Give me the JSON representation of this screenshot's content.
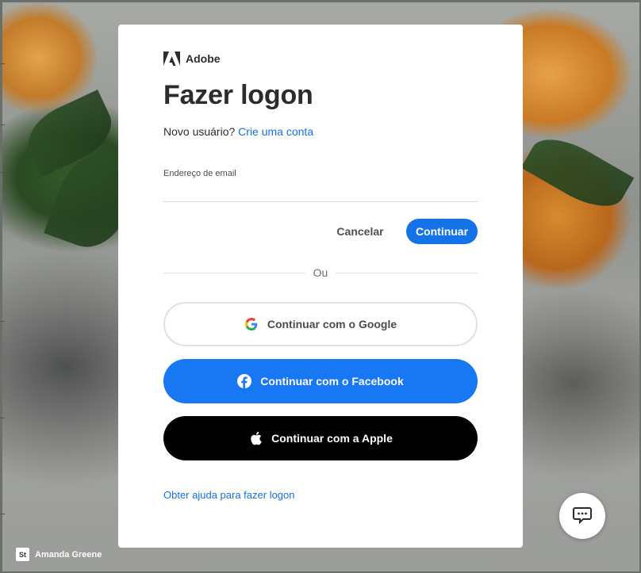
{
  "brand": {
    "name": "Adobe"
  },
  "login": {
    "title": "Fazer logon",
    "new_user_text": "Novo usuário?",
    "create_account_link": "Crie uma conta",
    "email_label": "Endereço de email",
    "email_value": "",
    "cancel_label": "Cancelar",
    "continue_label": "Continuar",
    "divider_text": "Ou",
    "google_label": "Continuar com o Google",
    "facebook_label": "Continuar com o Facebook",
    "apple_label": "Continuar com a Apple",
    "help_link": "Obter ajuda para fazer logon"
  },
  "photo_credit": {
    "badge": "St",
    "author": "Amanda Greene"
  },
  "icons": {
    "brand": "adobe-logo-icon",
    "google": "google-icon",
    "facebook": "facebook-icon",
    "apple": "apple-icon",
    "chat": "chat-icon"
  },
  "colors": {
    "accent": "#1473e6",
    "facebook": "#1877f2",
    "apple": "#000000",
    "text": "#2c2c2c"
  }
}
